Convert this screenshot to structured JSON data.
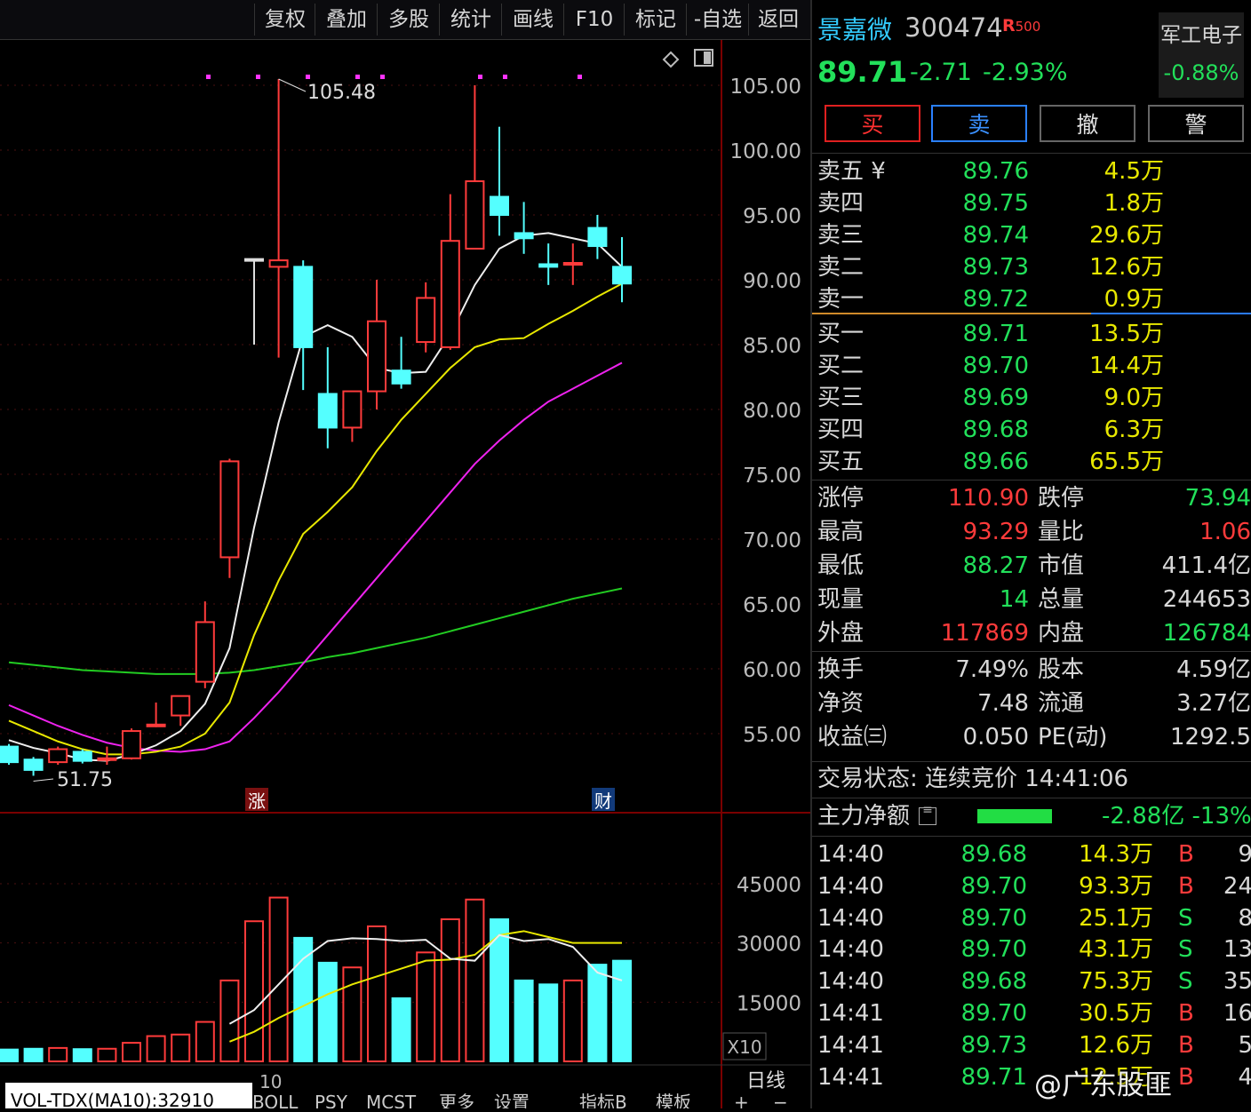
{
  "toolbar": {
    "buttons": [
      "复权",
      "叠加",
      "多股",
      "统计",
      "画线",
      "F10",
      "标记",
      "-自选",
      "返回"
    ]
  },
  "chart": {
    "price_axis": [
      "105.00",
      "100.00",
      "95.00",
      "90.00",
      "85.00",
      "80.00",
      "75.00",
      "70.00",
      "65.00",
      "60.00",
      "55.00"
    ],
    "high_label": "105.48",
    "low_label": "51.75",
    "marker_zhang": "涨",
    "marker_cai": "财",
    "vol_axis": [
      "45000",
      "30000",
      "15000"
    ],
    "vol_unit": "X10",
    "period": "日线",
    "x_label": "10",
    "indicator_label": "VOL-TDX(MA10):32910",
    "bottom_tabs": [
      "BOLL",
      "PSY",
      "MCST",
      "更多",
      "设置",
      "指标B",
      "模板",
      "+",
      "−"
    ]
  },
  "chart_data": {
    "type": "candlestick",
    "candles": [
      {
        "o": 54.0,
        "c": 52.8,
        "h": 54.2,
        "l": 52.6
      },
      {
        "o": 53.0,
        "c": 52.2,
        "h": 53.2,
        "l": 51.75
      },
      {
        "o": 52.8,
        "c": 53.8,
        "h": 54.0,
        "l": 52.6
      },
      {
        "o": 53.6,
        "c": 52.9,
        "h": 53.8,
        "l": 52.7
      },
      {
        "o": 53.0,
        "c": 53.1,
        "h": 54.0,
        "l": 52.6
      },
      {
        "o": 53.1,
        "c": 55.2,
        "h": 55.4,
        "l": 53.0
      },
      {
        "o": 55.6,
        "c": 55.7,
        "h": 57.4,
        "l": 55.5
      },
      {
        "o": 56.4,
        "c": 57.9,
        "h": 57.9,
        "l": 55.6
      },
      {
        "o": 59.0,
        "c": 63.6,
        "h": 65.2,
        "l": 58.5
      },
      {
        "o": 68.6,
        "c": 76.0,
        "h": 76.2,
        "l": 67.0
      },
      {
        "o": 91.6,
        "c": 91.6,
        "h": 91.6,
        "l": 85.0
      },
      {
        "o": 91.0,
        "c": 91.5,
        "h": 105.48,
        "l": 84.0
      },
      {
        "o": 91.0,
        "c": 84.8,
        "h": 91.5,
        "l": 81.5
      },
      {
        "o": 81.2,
        "c": 78.6,
        "h": 84.8,
        "l": 77.0
      },
      {
        "o": 78.6,
        "c": 81.4,
        "h": 81.4,
        "l": 77.5
      },
      {
        "o": 81.4,
        "c": 86.8,
        "h": 90.0,
        "l": 80.0
      },
      {
        "o": 83.0,
        "c": 82.0,
        "h": 85.6,
        "l": 81.6
      },
      {
        "o": 85.2,
        "c": 88.6,
        "h": 89.8,
        "l": 84.4
      },
      {
        "o": 84.8,
        "c": 93.0,
        "h": 96.6,
        "l": 84.6
      },
      {
        "o": 92.4,
        "c": 97.6,
        "h": 105.0,
        "l": 92.4
      },
      {
        "o": 96.4,
        "c": 95.0,
        "h": 101.8,
        "l": 93.4
      },
      {
        "o": 93.6,
        "c": 93.2,
        "h": 96.0,
        "l": 92.0
      },
      {
        "o": 91.2,
        "c": 91.0,
        "h": 92.8,
        "l": 89.6
      },
      {
        "o": 91.3,
        "c": 91.3,
        "h": 92.8,
        "l": 89.6
      },
      {
        "o": 94.0,
        "c": 92.6,
        "h": 95.0,
        "l": 91.6
      },
      {
        "o": 91.0,
        "c": 89.71,
        "h": 93.29,
        "l": 88.27
      }
    ],
    "ma5": [
      54.5,
      53.9,
      53.5,
      53.0,
      52.9,
      53.4,
      54.1,
      55.2,
      57.3,
      61.6,
      70.9,
      79.0,
      85.6,
      86.5,
      85.6,
      83.2,
      82.8,
      82.9,
      85.8,
      89.6,
      92.4,
      93.4,
      93.6,
      93.2,
      92.8,
      91.0
    ],
    "ma10": [
      56.0,
      55.2,
      54.4,
      53.8,
      53.4,
      53.4,
      53.6,
      54.0,
      55.0,
      57.4,
      62.6,
      66.8,
      70.4,
      72.1,
      74.0,
      76.8,
      79.2,
      81.2,
      83.2,
      84.8,
      85.4,
      85.5,
      86.6,
      87.6,
      88.7,
      89.7
    ],
    "ma20": [
      57.2,
      56.4,
      55.6,
      54.9,
      54.3,
      53.9,
      53.7,
      53.6,
      53.8,
      54.4,
      56.2,
      58.2,
      60.4,
      62.6,
      64.8,
      67.0,
      69.2,
      71.4,
      73.6,
      75.8,
      77.6,
      79.2,
      80.6,
      81.6,
      82.6,
      83.6
    ],
    "ma60": [
      60.5,
      60.3,
      60.1,
      59.9,
      59.8,
      59.7,
      59.6,
      59.6,
      59.6,
      59.7,
      59.9,
      60.2,
      60.5,
      60.9,
      61.2,
      61.6,
      62.0,
      62.4,
      62.9,
      63.4,
      63.9,
      64.4,
      64.9,
      65.4,
      65.8,
      66.2
    ],
    "volume": [
      3000,
      3200,
      3400,
      3100,
      3200,
      4700,
      6400,
      6800,
      10000,
      20500,
      35500,
      41500,
      31300,
      25000,
      23800,
      34200,
      16000,
      27600,
      36000,
      41000,
      36000,
      20500,
      19500,
      20500,
      24500,
      25500
    ],
    "vol_ma_white": [
      null,
      null,
      null,
      null,
      null,
      null,
      null,
      null,
      null,
      9500,
      13000,
      19500,
      26000,
      30500,
      31200,
      31000,
      30500,
      30800,
      26000,
      25500,
      32000,
      30500,
      31000,
      29000,
      22500,
      20500
    ],
    "vol_ma_yellow": [
      null,
      null,
      null,
      null,
      null,
      null,
      null,
      null,
      null,
      5000,
      7500,
      11000,
      14000,
      17000,
      19500,
      21500,
      23500,
      25500,
      25800,
      27000,
      32000,
      33000,
      31500,
      30000,
      30000,
      30000
    ],
    "ylim": [
      50.0,
      108.0
    ],
    "vol_ylim": [
      0,
      56000
    ]
  },
  "quote": {
    "name": "景嘉微",
    "code": "300474",
    "badge": "R",
    "badge_sub": "500",
    "sector_name": "军工电子",
    "sector_pct": "-0.88%",
    "price": "89.71",
    "change": "-2.71",
    "change_pct": "-2.93%",
    "buttons": [
      "买",
      "卖",
      "撤",
      "警"
    ],
    "asks": [
      {
        "label": "卖五 ¥",
        "price": "89.76",
        "vol": "4.5万"
      },
      {
        "label": "卖四",
        "price": "89.75",
        "vol": "1.8万"
      },
      {
        "label": "卖三",
        "price": "89.74",
        "vol": "29.6万"
      },
      {
        "label": "卖二",
        "price": "89.73",
        "vol": "12.6万"
      },
      {
        "label": "卖一",
        "price": "89.72",
        "vol": "0.9万"
      }
    ],
    "bids": [
      {
        "label": "买一",
        "price": "89.71",
        "vol": "13.5万"
      },
      {
        "label": "买二",
        "price": "89.70",
        "vol": "14.4万"
      },
      {
        "label": "买三",
        "price": "89.69",
        "vol": "9.0万"
      },
      {
        "label": "买四",
        "price": "89.68",
        "vol": "6.3万"
      },
      {
        "label": "买五",
        "price": "89.66",
        "vol": "65.5万"
      }
    ],
    "stats": [
      {
        "l1": "涨停",
        "v1": "110.90",
        "c1": "r",
        "l2": "跌停",
        "v2": "73.94",
        "c2": "g"
      },
      {
        "l1": "最高",
        "v1": "93.29",
        "c1": "r",
        "l2": "量比",
        "v2": "1.06",
        "c2": "r"
      },
      {
        "l1": "最低",
        "v1": "88.27",
        "c1": "g",
        "l2": "市值",
        "v2": "411.4亿",
        "c2": "w"
      },
      {
        "l1": "现量",
        "v1": "14",
        "c1": "g",
        "l2": "总量",
        "v2": "244653",
        "c2": "w"
      },
      {
        "l1": "外盘",
        "v1": "117869",
        "c1": "r",
        "l2": "内盘",
        "v2": "126784",
        "c2": "g"
      }
    ],
    "stats2": [
      {
        "l1": "换手",
        "v1": "7.49%",
        "l2": "股本",
        "v2": "4.59亿"
      },
      {
        "l1": "净资",
        "v1": "7.48",
        "l2": "流通",
        "v2": "3.27亿"
      },
      {
        "l1": "收益㈢",
        "v1": "0.050",
        "l2": "PE(动)",
        "v2": "1292.5"
      }
    ],
    "trade_status": "交易状态: 连续竞价 14:41:06",
    "main_flow_label": "主力净额",
    "main_flow_value": "-2.88亿 -13%",
    "ticks": [
      {
        "t": "14:40",
        "p": "89.68",
        "v": "14.3万",
        "s": "B",
        "n": "9"
      },
      {
        "t": "14:40",
        "p": "89.70",
        "v": "93.3万",
        "s": "B",
        "n": "24"
      },
      {
        "t": "14:40",
        "p": "89.70",
        "v": "25.1万",
        "s": "S",
        "n": "8"
      },
      {
        "t": "14:40",
        "p": "89.70",
        "v": "43.1万",
        "s": "S",
        "n": "13"
      },
      {
        "t": "14:40",
        "p": "89.68",
        "v": "75.3万",
        "s": "S",
        "n": "35"
      },
      {
        "t": "14:41",
        "p": "89.70",
        "v": "30.5万",
        "s": "B",
        "n": "16"
      },
      {
        "t": "14:41",
        "p": "89.73",
        "v": "12.6万",
        "s": "B",
        "n": "5"
      },
      {
        "t": "14:41",
        "p": "89.71",
        "v": "12.5万",
        "s": "B",
        "n": "4"
      }
    ],
    "watermark": "@广东股匪"
  }
}
